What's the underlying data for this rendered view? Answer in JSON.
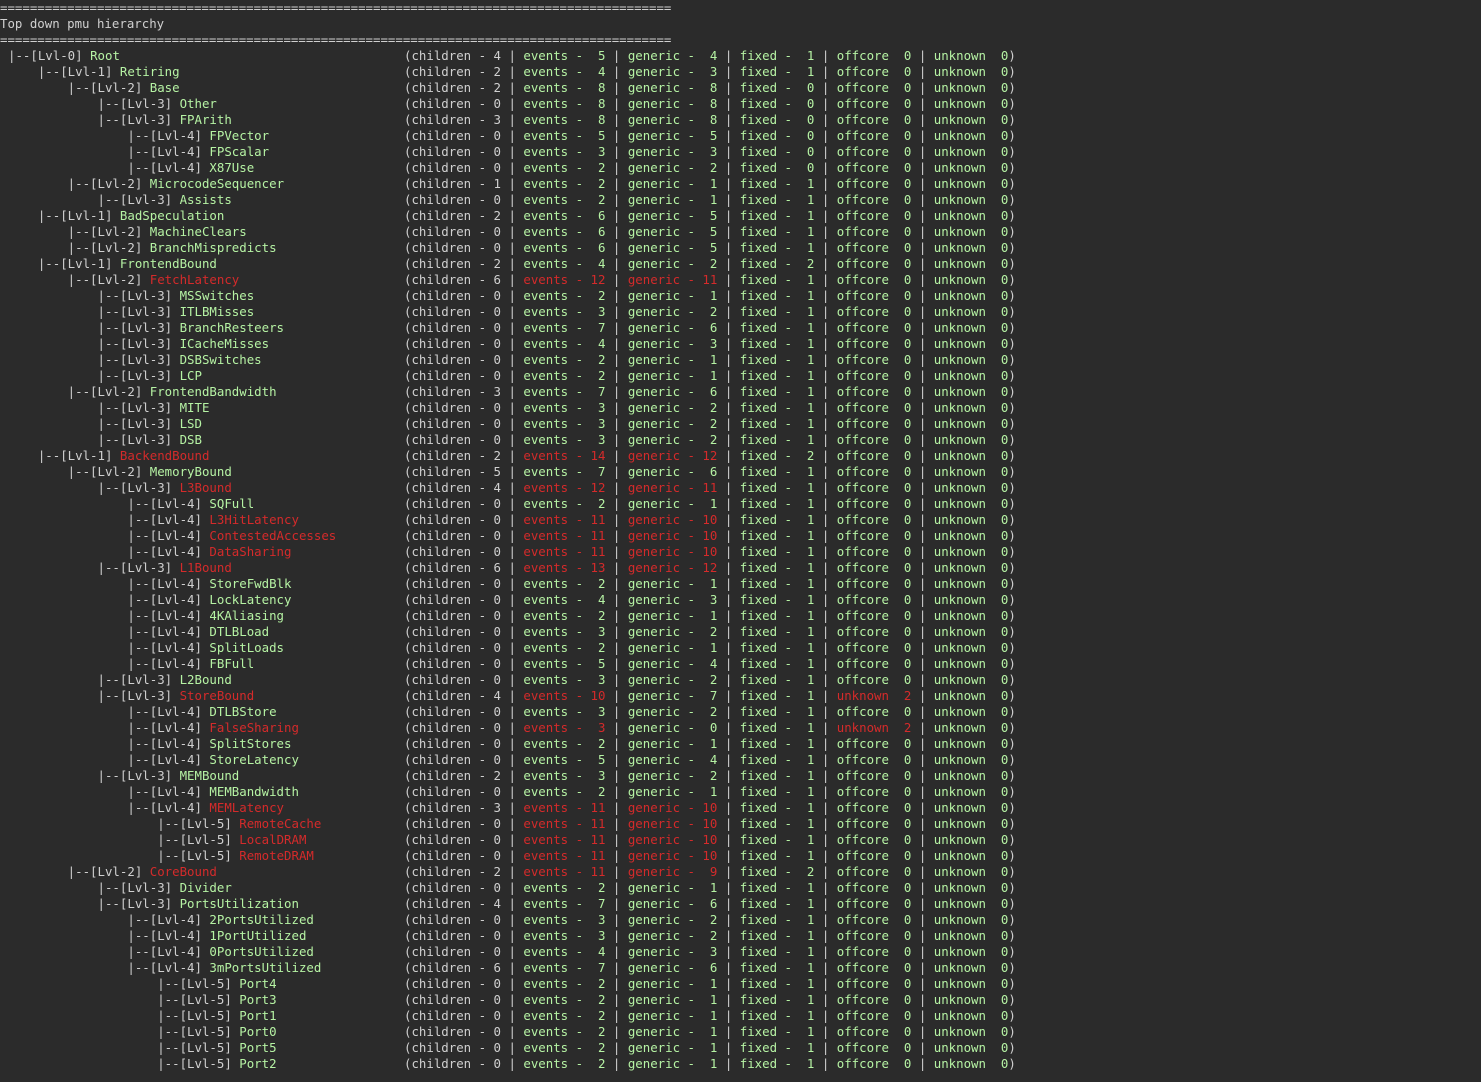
{
  "title": "Top down pmu hierarchy",
  "separator": "==========================================================================================",
  "colors": {
    "normal": "#b6f3a4",
    "warn": "#d42b2b",
    "text": "#d0d0d0",
    "bg": "#2b2b2b"
  },
  "labels": {
    "children": "children",
    "events": "events",
    "generic": "generic",
    "fixed": "fixed",
    "offcore": "offcore",
    "unknown": "unknown"
  },
  "rows": [
    {
      "lvl": 0,
      "name": "Root",
      "c": 4,
      "e": 5,
      "g": 4,
      "f": 1,
      "o": 0,
      "u": 0,
      "hi": []
    },
    {
      "lvl": 1,
      "name": "Retiring",
      "c": 2,
      "e": 4,
      "g": 3,
      "f": 1,
      "o": 0,
      "u": 0,
      "hi": []
    },
    {
      "lvl": 2,
      "name": "Base",
      "c": 2,
      "e": 8,
      "g": 8,
      "f": 0,
      "o": 0,
      "u": 0,
      "hi": []
    },
    {
      "lvl": 3,
      "name": "Other",
      "c": 0,
      "e": 8,
      "g": 8,
      "f": 0,
      "o": 0,
      "u": 0,
      "hi": []
    },
    {
      "lvl": 3,
      "name": "FPArith",
      "c": 3,
      "e": 8,
      "g": 8,
      "f": 0,
      "o": 0,
      "u": 0,
      "hi": []
    },
    {
      "lvl": 4,
      "name": "FPVector",
      "c": 0,
      "e": 5,
      "g": 5,
      "f": 0,
      "o": 0,
      "u": 0,
      "hi": []
    },
    {
      "lvl": 4,
      "name": "FPScalar",
      "c": 0,
      "e": 3,
      "g": 3,
      "f": 0,
      "o": 0,
      "u": 0,
      "hi": []
    },
    {
      "lvl": 4,
      "name": "X87Use",
      "c": 0,
      "e": 2,
      "g": 2,
      "f": 0,
      "o": 0,
      "u": 0,
      "hi": []
    },
    {
      "lvl": 2,
      "name": "MicrocodeSequencer",
      "c": 1,
      "e": 2,
      "g": 1,
      "f": 1,
      "o": 0,
      "u": 0,
      "hi": []
    },
    {
      "lvl": 3,
      "name": "Assists",
      "c": 0,
      "e": 2,
      "g": 1,
      "f": 1,
      "o": 0,
      "u": 0,
      "hi": []
    },
    {
      "lvl": 1,
      "name": "BadSpeculation",
      "c": 2,
      "e": 6,
      "g": 5,
      "f": 1,
      "o": 0,
      "u": 0,
      "hi": []
    },
    {
      "lvl": 2,
      "name": "MachineClears",
      "c": 0,
      "e": 6,
      "g": 5,
      "f": 1,
      "o": 0,
      "u": 0,
      "hi": []
    },
    {
      "lvl": 2,
      "name": "BranchMispredicts",
      "c": 0,
      "e": 6,
      "g": 5,
      "f": 1,
      "o": 0,
      "u": 0,
      "hi": []
    },
    {
      "lvl": 1,
      "name": "FrontendBound",
      "c": 2,
      "e": 4,
      "g": 2,
      "f": 2,
      "o": 0,
      "u": 0,
      "hi": []
    },
    {
      "lvl": 2,
      "name": "FetchLatency",
      "c": 6,
      "e": 12,
      "g": 11,
      "f": 1,
      "o": 0,
      "u": 0,
      "hi": [
        "name",
        "e",
        "g"
      ]
    },
    {
      "lvl": 3,
      "name": "MSSwitches",
      "c": 0,
      "e": 2,
      "g": 1,
      "f": 1,
      "o": 0,
      "u": 0,
      "hi": []
    },
    {
      "lvl": 3,
      "name": "ITLBMisses",
      "c": 0,
      "e": 3,
      "g": 2,
      "f": 1,
      "o": 0,
      "u": 0,
      "hi": []
    },
    {
      "lvl": 3,
      "name": "BranchResteers",
      "c": 0,
      "e": 7,
      "g": 6,
      "f": 1,
      "o": 0,
      "u": 0,
      "hi": []
    },
    {
      "lvl": 3,
      "name": "ICacheMisses",
      "c": 0,
      "e": 4,
      "g": 3,
      "f": 1,
      "o": 0,
      "u": 0,
      "hi": []
    },
    {
      "lvl": 3,
      "name": "DSBSwitches",
      "c": 0,
      "e": 2,
      "g": 1,
      "f": 1,
      "o": 0,
      "u": 0,
      "hi": []
    },
    {
      "lvl": 3,
      "name": "LCP",
      "c": 0,
      "e": 2,
      "g": 1,
      "f": 1,
      "o": 0,
      "u": 0,
      "hi": []
    },
    {
      "lvl": 2,
      "name": "FrontendBandwidth",
      "c": 3,
      "e": 7,
      "g": 6,
      "f": 1,
      "o": 0,
      "u": 0,
      "hi": []
    },
    {
      "lvl": 3,
      "name": "MITE",
      "c": 0,
      "e": 3,
      "g": 2,
      "f": 1,
      "o": 0,
      "u": 0,
      "hi": []
    },
    {
      "lvl": 3,
      "name": "LSD",
      "c": 0,
      "e": 3,
      "g": 2,
      "f": 1,
      "o": 0,
      "u": 0,
      "hi": []
    },
    {
      "lvl": 3,
      "name": "DSB",
      "c": 0,
      "e": 3,
      "g": 2,
      "f": 1,
      "o": 0,
      "u": 0,
      "hi": []
    },
    {
      "lvl": 1,
      "name": "BackendBound",
      "c": 2,
      "e": 14,
      "g": 12,
      "f": 2,
      "o": 0,
      "u": 0,
      "hi": [
        "name",
        "e",
        "g"
      ]
    },
    {
      "lvl": 2,
      "name": "MemoryBound",
      "c": 5,
      "e": 7,
      "g": 6,
      "f": 1,
      "o": 0,
      "u": 0,
      "hi": []
    },
    {
      "lvl": 3,
      "name": "L3Bound",
      "c": 4,
      "e": 12,
      "g": 11,
      "f": 1,
      "o": 0,
      "u": 0,
      "hi": [
        "name",
        "e",
        "g"
      ]
    },
    {
      "lvl": 4,
      "name": "SQFull",
      "c": 0,
      "e": 2,
      "g": 1,
      "f": 1,
      "o": 0,
      "u": 0,
      "hi": []
    },
    {
      "lvl": 4,
      "name": "L3HitLatency",
      "c": 0,
      "e": 11,
      "g": 10,
      "f": 1,
      "o": 0,
      "u": 0,
      "hi": [
        "name",
        "e",
        "g"
      ]
    },
    {
      "lvl": 4,
      "name": "ContestedAccesses",
      "c": 0,
      "e": 11,
      "g": 10,
      "f": 1,
      "o": 0,
      "u": 0,
      "hi": [
        "name",
        "e",
        "g"
      ]
    },
    {
      "lvl": 4,
      "name": "DataSharing",
      "c": 0,
      "e": 11,
      "g": 10,
      "f": 1,
      "o": 0,
      "u": 0,
      "hi": [
        "name",
        "e",
        "g"
      ]
    },
    {
      "lvl": 3,
      "name": "L1Bound",
      "c": 6,
      "e": 13,
      "g": 12,
      "f": 1,
      "o": 0,
      "u": 0,
      "hi": [
        "name",
        "e",
        "g"
      ]
    },
    {
      "lvl": 4,
      "name": "StoreFwdBlk",
      "c": 0,
      "e": 2,
      "g": 1,
      "f": 1,
      "o": 0,
      "u": 0,
      "hi": []
    },
    {
      "lvl": 4,
      "name": "LockLatency",
      "c": 0,
      "e": 4,
      "g": 3,
      "f": 1,
      "o": 0,
      "u": 0,
      "hi": []
    },
    {
      "lvl": 4,
      "name": "4KAliasing",
      "c": 0,
      "e": 2,
      "g": 1,
      "f": 1,
      "o": 0,
      "u": 0,
      "hi": []
    },
    {
      "lvl": 4,
      "name": "DTLBLoad",
      "c": 0,
      "e": 3,
      "g": 2,
      "f": 1,
      "o": 0,
      "u": 0,
      "hi": []
    },
    {
      "lvl": 4,
      "name": "SplitLoads",
      "c": 0,
      "e": 2,
      "g": 1,
      "f": 1,
      "o": 0,
      "u": 0,
      "hi": []
    },
    {
      "lvl": 4,
      "name": "FBFull",
      "c": 0,
      "e": 5,
      "g": 4,
      "f": 1,
      "o": 0,
      "u": 0,
      "hi": []
    },
    {
      "lvl": 3,
      "name": "L2Bound",
      "c": 0,
      "e": 3,
      "g": 2,
      "f": 1,
      "o": 0,
      "u": 0,
      "hi": []
    },
    {
      "lvl": 3,
      "name": "StoreBound",
      "c": 4,
      "e": 10,
      "g": 7,
      "f": 1,
      "o": 2,
      "u": 0,
      "hi": [
        "name",
        "e",
        "o"
      ],
      "o_label": "unknown"
    },
    {
      "lvl": 4,
      "name": "DTLBStore",
      "c": 0,
      "e": 3,
      "g": 2,
      "f": 1,
      "o": 0,
      "u": 0,
      "hi": []
    },
    {
      "lvl": 4,
      "name": "FalseSharing",
      "c": 0,
      "e": 3,
      "g": 0,
      "f": 1,
      "o": 2,
      "u": 0,
      "hi": [
        "name",
        "e",
        "o"
      ],
      "o_label": "unknown"
    },
    {
      "lvl": 4,
      "name": "SplitStores",
      "c": 0,
      "e": 2,
      "g": 1,
      "f": 1,
      "o": 0,
      "u": 0,
      "hi": []
    },
    {
      "lvl": 4,
      "name": "StoreLatency",
      "c": 0,
      "e": 5,
      "g": 4,
      "f": 1,
      "o": 0,
      "u": 0,
      "hi": []
    },
    {
      "lvl": 3,
      "name": "MEMBound",
      "c": 2,
      "e": 3,
      "g": 2,
      "f": 1,
      "o": 0,
      "u": 0,
      "hi": []
    },
    {
      "lvl": 4,
      "name": "MEMBandwidth",
      "c": 0,
      "e": 2,
      "g": 1,
      "f": 1,
      "o": 0,
      "u": 0,
      "hi": []
    },
    {
      "lvl": 4,
      "name": "MEMLatency",
      "c": 3,
      "e": 11,
      "g": 10,
      "f": 1,
      "o": 0,
      "u": 0,
      "hi": [
        "name",
        "e",
        "g"
      ]
    },
    {
      "lvl": 5,
      "name": "RemoteCache",
      "c": 0,
      "e": 11,
      "g": 10,
      "f": 1,
      "o": 0,
      "u": 0,
      "hi": [
        "name",
        "e",
        "g"
      ]
    },
    {
      "lvl": 5,
      "name": "LocalDRAM",
      "c": 0,
      "e": 11,
      "g": 10,
      "f": 1,
      "o": 0,
      "u": 0,
      "hi": [
        "name",
        "e",
        "g"
      ]
    },
    {
      "lvl": 5,
      "name": "RemoteDRAM",
      "c": 0,
      "e": 11,
      "g": 10,
      "f": 1,
      "o": 0,
      "u": 0,
      "hi": [
        "name",
        "e",
        "g"
      ]
    },
    {
      "lvl": 2,
      "name": "CoreBound",
      "c": 2,
      "e": 11,
      "g": 9,
      "f": 2,
      "o": 0,
      "u": 0,
      "hi": [
        "name",
        "e",
        "g"
      ]
    },
    {
      "lvl": 3,
      "name": "Divider",
      "c": 0,
      "e": 2,
      "g": 1,
      "f": 1,
      "o": 0,
      "u": 0,
      "hi": []
    },
    {
      "lvl": 3,
      "name": "PortsUtilization",
      "c": 4,
      "e": 7,
      "g": 6,
      "f": 1,
      "o": 0,
      "u": 0,
      "hi": []
    },
    {
      "lvl": 4,
      "name": "2PortsUtilized",
      "c": 0,
      "e": 3,
      "g": 2,
      "f": 1,
      "o": 0,
      "u": 0,
      "hi": []
    },
    {
      "lvl": 4,
      "name": "1PortUtilized",
      "c": 0,
      "e": 3,
      "g": 2,
      "f": 1,
      "o": 0,
      "u": 0,
      "hi": []
    },
    {
      "lvl": 4,
      "name": "0PortsUtilized",
      "c": 0,
      "e": 4,
      "g": 3,
      "f": 1,
      "o": 0,
      "u": 0,
      "hi": []
    },
    {
      "lvl": 4,
      "name": "3mPortsUtilized",
      "c": 6,
      "e": 7,
      "g": 6,
      "f": 1,
      "o": 0,
      "u": 0,
      "hi": []
    },
    {
      "lvl": 5,
      "name": "Port4",
      "c": 0,
      "e": 2,
      "g": 1,
      "f": 1,
      "o": 0,
      "u": 0,
      "hi": []
    },
    {
      "lvl": 5,
      "name": "Port3",
      "c": 0,
      "e": 2,
      "g": 1,
      "f": 1,
      "o": 0,
      "u": 0,
      "hi": []
    },
    {
      "lvl": 5,
      "name": "Port1",
      "c": 0,
      "e": 2,
      "g": 1,
      "f": 1,
      "o": 0,
      "u": 0,
      "hi": []
    },
    {
      "lvl": 5,
      "name": "Port0",
      "c": 0,
      "e": 2,
      "g": 1,
      "f": 1,
      "o": 0,
      "u": 0,
      "hi": []
    },
    {
      "lvl": 5,
      "name": "Port5",
      "c": 0,
      "e": 2,
      "g": 1,
      "f": 1,
      "o": 0,
      "u": 0,
      "hi": []
    },
    {
      "lvl": 5,
      "name": "Port2",
      "c": 0,
      "e": 2,
      "g": 1,
      "f": 1,
      "o": 0,
      "u": 0,
      "hi": []
    }
  ]
}
